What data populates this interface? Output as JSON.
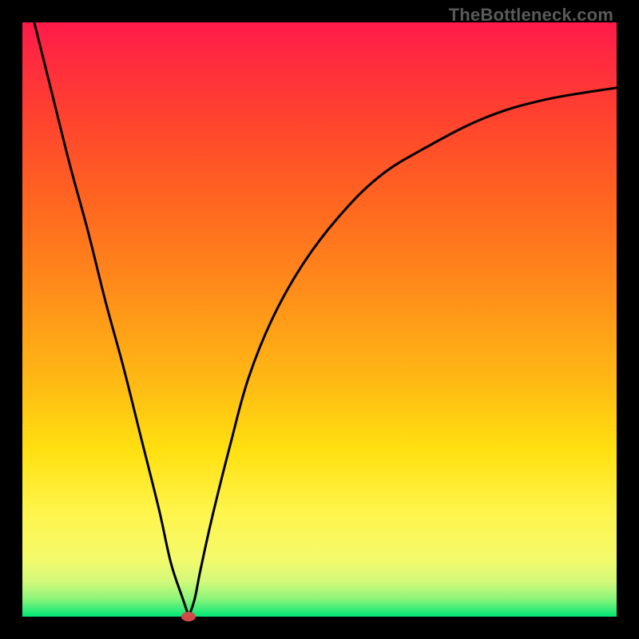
{
  "watermark": "TheBottleneck.com",
  "chart_data": {
    "type": "line",
    "title": "",
    "xlabel": "",
    "ylabel": "",
    "xlim": [
      0,
      100
    ],
    "ylim": [
      0,
      100
    ],
    "grid": false,
    "legend": false,
    "annotations": [],
    "series": [
      {
        "name": "left-branch",
        "x": [
          2,
          5,
          8,
          11,
          14,
          17,
          20,
          23,
          25,
          27,
          28
        ],
        "values": [
          100,
          88,
          76,
          65,
          53,
          42,
          30,
          18,
          9,
          3,
          0
        ]
      },
      {
        "name": "right-branch",
        "x": [
          28,
          29,
          30,
          32,
          35,
          38,
          42,
          47,
          53,
          60,
          68,
          78,
          88,
          100
        ],
        "values": [
          0,
          3,
          8,
          17,
          29,
          40,
          50,
          59,
          67,
          74,
          79,
          84,
          87,
          89
        ]
      }
    ],
    "marker": {
      "x": 28,
      "y": 0
    },
    "background_gradient": {
      "stops": [
        {
          "pos": 0,
          "color": "#ff1a4a"
        },
        {
          "pos": 15,
          "color": "#ff4030"
        },
        {
          "pos": 45,
          "color": "#ff8c1a"
        },
        {
          "pos": 72,
          "color": "#ffe010"
        },
        {
          "pos": 90,
          "color": "#f5fa6a"
        },
        {
          "pos": 100,
          "color": "#00e676"
        }
      ]
    }
  }
}
